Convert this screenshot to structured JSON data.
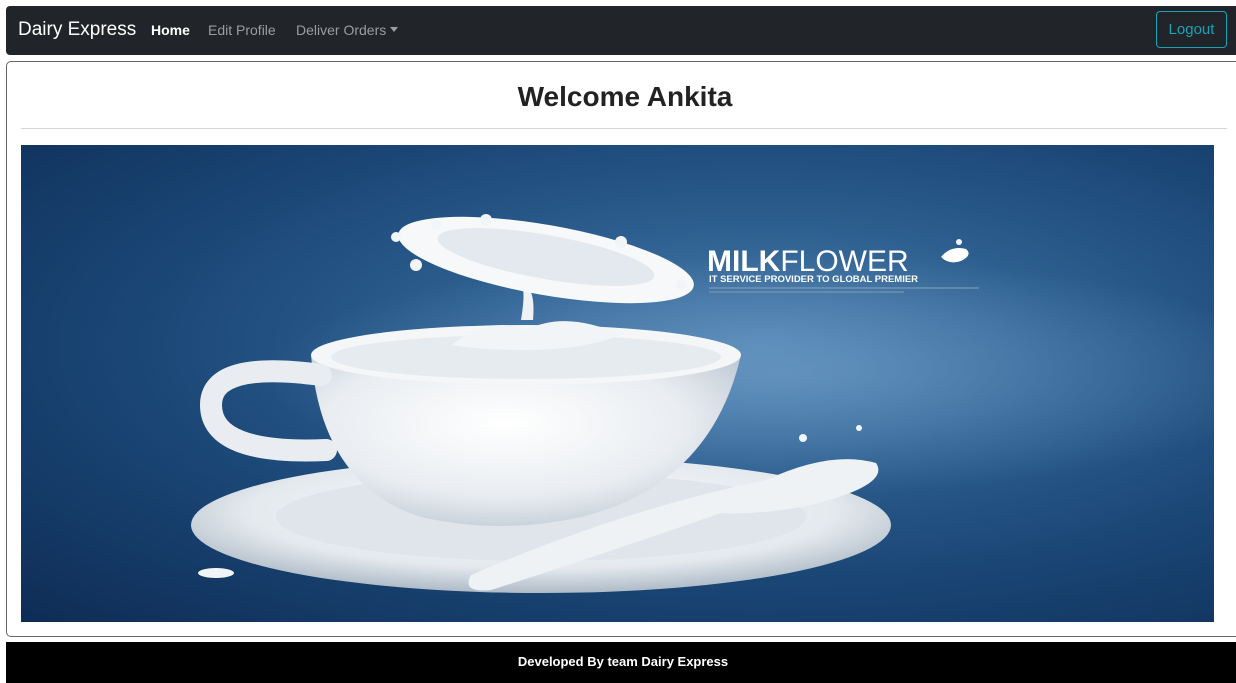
{
  "navbar": {
    "brand": "Dairy Express",
    "links": [
      {
        "label": "Home",
        "active": true
      },
      {
        "label": "Edit Profile",
        "active": false
      },
      {
        "label": "Deliver Orders",
        "active": false
      }
    ],
    "logout_label": "Logout",
    "colors": {
      "background": "#212529",
      "accent": "#17a2b8"
    }
  },
  "main": {
    "welcome_title": "Welcome Ankita",
    "banner": {
      "brand_bold": "MILK",
      "brand_light": "FLOWER",
      "tagline": "IT SERVICE PROVIDER TO GLOBAL PREMIER"
    }
  },
  "footer": {
    "text": "Developed By team Dairy Express"
  }
}
